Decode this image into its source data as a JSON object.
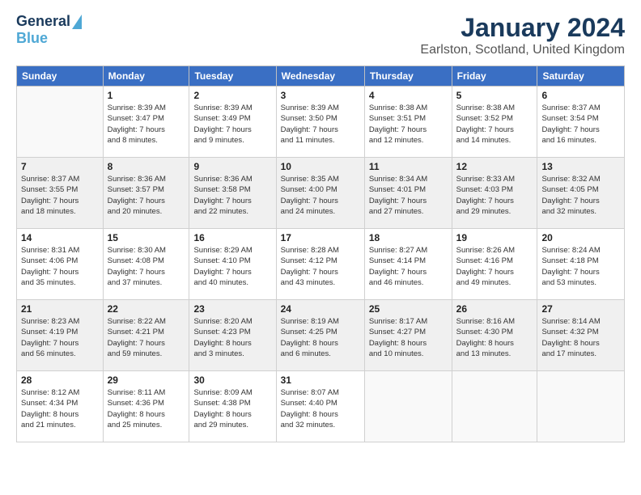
{
  "logo": {
    "general": "General",
    "blue": "Blue"
  },
  "title": "January 2024",
  "subtitle": "Earlston, Scotland, United Kingdom",
  "days_header": [
    "Sunday",
    "Monday",
    "Tuesday",
    "Wednesday",
    "Thursday",
    "Friday",
    "Saturday"
  ],
  "weeks": [
    [
      {
        "day": "",
        "lines": []
      },
      {
        "day": "1",
        "lines": [
          "Sunrise: 8:39 AM",
          "Sunset: 3:47 PM",
          "Daylight: 7 hours",
          "and 8 minutes."
        ]
      },
      {
        "day": "2",
        "lines": [
          "Sunrise: 8:39 AM",
          "Sunset: 3:49 PM",
          "Daylight: 7 hours",
          "and 9 minutes."
        ]
      },
      {
        "day": "3",
        "lines": [
          "Sunrise: 8:39 AM",
          "Sunset: 3:50 PM",
          "Daylight: 7 hours",
          "and 11 minutes."
        ]
      },
      {
        "day": "4",
        "lines": [
          "Sunrise: 8:38 AM",
          "Sunset: 3:51 PM",
          "Daylight: 7 hours",
          "and 12 minutes."
        ]
      },
      {
        "day": "5",
        "lines": [
          "Sunrise: 8:38 AM",
          "Sunset: 3:52 PM",
          "Daylight: 7 hours",
          "and 14 minutes."
        ]
      },
      {
        "day": "6",
        "lines": [
          "Sunrise: 8:37 AM",
          "Sunset: 3:54 PM",
          "Daylight: 7 hours",
          "and 16 minutes."
        ]
      }
    ],
    [
      {
        "day": "7",
        "lines": [
          "Sunrise: 8:37 AM",
          "Sunset: 3:55 PM",
          "Daylight: 7 hours",
          "and 18 minutes."
        ]
      },
      {
        "day": "8",
        "lines": [
          "Sunrise: 8:36 AM",
          "Sunset: 3:57 PM",
          "Daylight: 7 hours",
          "and 20 minutes."
        ]
      },
      {
        "day": "9",
        "lines": [
          "Sunrise: 8:36 AM",
          "Sunset: 3:58 PM",
          "Daylight: 7 hours",
          "and 22 minutes."
        ]
      },
      {
        "day": "10",
        "lines": [
          "Sunrise: 8:35 AM",
          "Sunset: 4:00 PM",
          "Daylight: 7 hours",
          "and 24 minutes."
        ]
      },
      {
        "day": "11",
        "lines": [
          "Sunrise: 8:34 AM",
          "Sunset: 4:01 PM",
          "Daylight: 7 hours",
          "and 27 minutes."
        ]
      },
      {
        "day": "12",
        "lines": [
          "Sunrise: 8:33 AM",
          "Sunset: 4:03 PM",
          "Daylight: 7 hours",
          "and 29 minutes."
        ]
      },
      {
        "day": "13",
        "lines": [
          "Sunrise: 8:32 AM",
          "Sunset: 4:05 PM",
          "Daylight: 7 hours",
          "and 32 minutes."
        ]
      }
    ],
    [
      {
        "day": "14",
        "lines": [
          "Sunrise: 8:31 AM",
          "Sunset: 4:06 PM",
          "Daylight: 7 hours",
          "and 35 minutes."
        ]
      },
      {
        "day": "15",
        "lines": [
          "Sunrise: 8:30 AM",
          "Sunset: 4:08 PM",
          "Daylight: 7 hours",
          "and 37 minutes."
        ]
      },
      {
        "day": "16",
        "lines": [
          "Sunrise: 8:29 AM",
          "Sunset: 4:10 PM",
          "Daylight: 7 hours",
          "and 40 minutes."
        ]
      },
      {
        "day": "17",
        "lines": [
          "Sunrise: 8:28 AM",
          "Sunset: 4:12 PM",
          "Daylight: 7 hours",
          "and 43 minutes."
        ]
      },
      {
        "day": "18",
        "lines": [
          "Sunrise: 8:27 AM",
          "Sunset: 4:14 PM",
          "Daylight: 7 hours",
          "and 46 minutes."
        ]
      },
      {
        "day": "19",
        "lines": [
          "Sunrise: 8:26 AM",
          "Sunset: 4:16 PM",
          "Daylight: 7 hours",
          "and 49 minutes."
        ]
      },
      {
        "day": "20",
        "lines": [
          "Sunrise: 8:24 AM",
          "Sunset: 4:18 PM",
          "Daylight: 7 hours",
          "and 53 minutes."
        ]
      }
    ],
    [
      {
        "day": "21",
        "lines": [
          "Sunrise: 8:23 AM",
          "Sunset: 4:19 PM",
          "Daylight: 7 hours",
          "and 56 minutes."
        ]
      },
      {
        "day": "22",
        "lines": [
          "Sunrise: 8:22 AM",
          "Sunset: 4:21 PM",
          "Daylight: 7 hours",
          "and 59 minutes."
        ]
      },
      {
        "day": "23",
        "lines": [
          "Sunrise: 8:20 AM",
          "Sunset: 4:23 PM",
          "Daylight: 8 hours",
          "and 3 minutes."
        ]
      },
      {
        "day": "24",
        "lines": [
          "Sunrise: 8:19 AM",
          "Sunset: 4:25 PM",
          "Daylight: 8 hours",
          "and 6 minutes."
        ]
      },
      {
        "day": "25",
        "lines": [
          "Sunrise: 8:17 AM",
          "Sunset: 4:27 PM",
          "Daylight: 8 hours",
          "and 10 minutes."
        ]
      },
      {
        "day": "26",
        "lines": [
          "Sunrise: 8:16 AM",
          "Sunset: 4:30 PM",
          "Daylight: 8 hours",
          "and 13 minutes."
        ]
      },
      {
        "day": "27",
        "lines": [
          "Sunrise: 8:14 AM",
          "Sunset: 4:32 PM",
          "Daylight: 8 hours",
          "and 17 minutes."
        ]
      }
    ],
    [
      {
        "day": "28",
        "lines": [
          "Sunrise: 8:12 AM",
          "Sunset: 4:34 PM",
          "Daylight: 8 hours",
          "and 21 minutes."
        ]
      },
      {
        "day": "29",
        "lines": [
          "Sunrise: 8:11 AM",
          "Sunset: 4:36 PM",
          "Daylight: 8 hours",
          "and 25 minutes."
        ]
      },
      {
        "day": "30",
        "lines": [
          "Sunrise: 8:09 AM",
          "Sunset: 4:38 PM",
          "Daylight: 8 hours",
          "and 29 minutes."
        ]
      },
      {
        "day": "31",
        "lines": [
          "Sunrise: 8:07 AM",
          "Sunset: 4:40 PM",
          "Daylight: 8 hours",
          "and 32 minutes."
        ]
      },
      {
        "day": "",
        "lines": []
      },
      {
        "day": "",
        "lines": []
      },
      {
        "day": "",
        "lines": []
      }
    ]
  ]
}
